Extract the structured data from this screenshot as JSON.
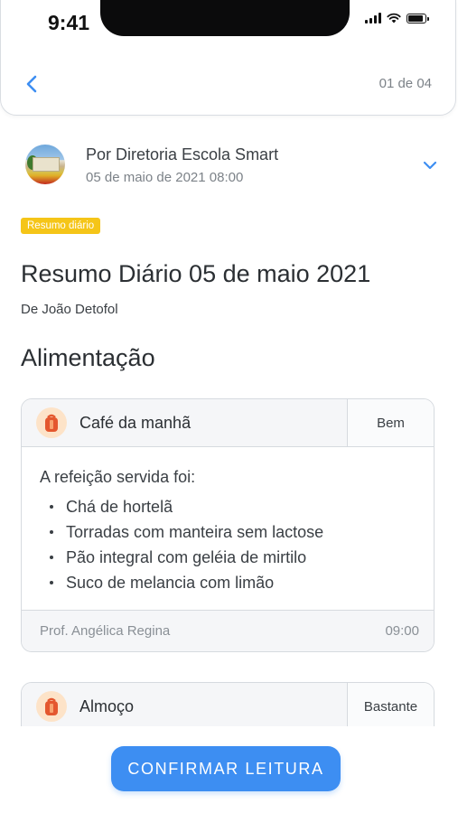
{
  "status_bar": {
    "time": "9:41"
  },
  "header": {
    "pager": "01 de 04"
  },
  "post": {
    "sender": "Por Diretoria Escola Smart",
    "date": "05 de maio de 2021  08:00",
    "tag": "Resumo diário",
    "title": "Resumo Diário 05 de maio 2021",
    "author": "De João Detofol",
    "section": "Alimentação"
  },
  "meals": [
    {
      "title": "Café da manhã",
      "rating": "Bem",
      "intro": "A refeição servida foi:",
      "items": [
        "Chá de hortelã",
        "Torradas com manteira sem lactose",
        "Pão integral com geléia de mirtilo",
        "Suco de melancia com limão"
      ],
      "teacher": "Prof. Angélica Regina",
      "time": "09:00"
    },
    {
      "title": "Almoço",
      "rating": "Bastante"
    }
  ],
  "footer": {
    "confirm_label": "CONFIRMAR LEITURA"
  },
  "colors": {
    "accent": "#3d8ef2",
    "tag": "#f5c518",
    "meal_icon_bg": "#fde3c8",
    "meal_icon": "#e4572e"
  }
}
